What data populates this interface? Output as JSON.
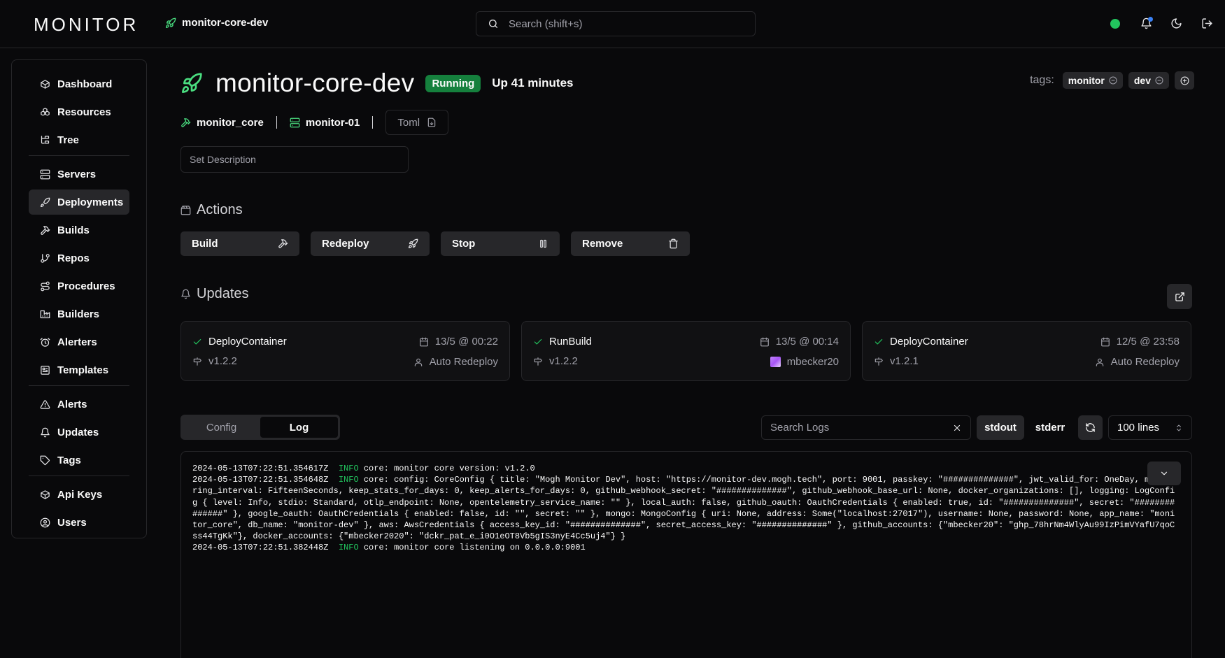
{
  "app": {
    "logo": "MONITOR",
    "breadcrumb": "monitor-core-dev",
    "search_placeholder": "Search (shift+s)",
    "status_color": "#22c55e"
  },
  "sidebar": {
    "items": [
      {
        "label": "Dashboard",
        "icon": "box-icon"
      },
      {
        "label": "Resources",
        "icon": "boxes-icon"
      },
      {
        "label": "Tree",
        "icon": "tree-icon"
      },
      {
        "label": "Servers",
        "icon": "server-icon"
      },
      {
        "label": "Deployments",
        "icon": "rocket-icon",
        "active": true
      },
      {
        "label": "Builds",
        "icon": "hammer-icon"
      },
      {
        "label": "Repos",
        "icon": "git-branch-icon"
      },
      {
        "label": "Procedures",
        "icon": "route-icon"
      },
      {
        "label": "Builders",
        "icon": "factory-icon"
      },
      {
        "label": "Alerters",
        "icon": "alarm-icon"
      },
      {
        "label": "Templates",
        "icon": "template-icon"
      },
      {
        "label": "Alerts",
        "icon": "alert-triangle-icon"
      },
      {
        "label": "Updates",
        "icon": "bell-icon"
      },
      {
        "label": "Tags",
        "icon": "tag-icon"
      },
      {
        "label": "Api Keys",
        "icon": "box-icon"
      },
      {
        "label": "Users",
        "icon": "user-circle-icon"
      }
    ]
  },
  "deployment": {
    "name": "monitor-core-dev",
    "state": "Running",
    "state_color": "#15803d",
    "uptime": "Up 41 minutes",
    "build": "monitor_core",
    "server": "monitor-01",
    "toml_label": "Toml",
    "description_placeholder": "Set Description"
  },
  "tags": {
    "label": "tags:",
    "items": [
      "monitor",
      "dev"
    ]
  },
  "actions": {
    "title": "Actions",
    "buttons": [
      "Build",
      "Redeploy",
      "Stop",
      "Remove"
    ]
  },
  "updates": {
    "title": "Updates",
    "items": [
      {
        "operation": "DeployContainer",
        "version": "v1.2.2",
        "time": "13/5 @ 00:22",
        "user": "Auto Redeploy"
      },
      {
        "operation": "RunBuild",
        "version": "v1.2.2",
        "time": "13/5 @ 00:14",
        "user": "mbecker20"
      },
      {
        "operation": "DeployContainer",
        "version": "v1.2.1",
        "time": "12/5 @ 23:58",
        "user": "Auto Redeploy"
      }
    ]
  },
  "log_panel": {
    "tabs": [
      "Config",
      "Log"
    ],
    "active_tab": "Log",
    "search_placeholder": "Search Logs",
    "stdout_label": "stdout",
    "stderr_label": "stderr",
    "lines_value": "100 lines",
    "lines": [
      {
        "ts": "2024-05-13T07:22:51.354617Z",
        "level": "INFO",
        "msg": "core: monitor core version: v1.2.0"
      },
      {
        "ts": "2024-05-13T07:22:51.354648Z",
        "level": "INFO",
        "msg": "core: config: CoreConfig { title: \"Mogh Monitor Dev\", host: \"https://monitor-dev.mogh.tech\", port: 9001, passkey: \"##############\", jwt_valid_for: OneDay, monitoring_interval: FifteenSeconds, keep_stats_for_days: 0, keep_alerts_for_days: 0, github_webhook_secret: \"##############\", github_webhook_base_url: None, docker_organizations: [], logging: LogConfig { level: Info, stdio: Standard, otlp_endpoint: None, opentelemetry_service_name: \"\" }, local_auth: false, github_oauth: OauthCredentials { enabled: true, id: \"##############\", secret: \"##############\" }, google_oauth: OauthCredentials { enabled: false, id: \"\", secret: \"\" }, mongo: MongoConfig { uri: None, address: Some(\"localhost:27017\"), username: None, password: None, app_name: \"monitor_core\", db_name: \"monitor-dev\" }, aws: AwsCredentials { access_key_id: \"##############\", secret_access_key: \"##############\" }, github_accounts: {\"mbecker20\": \"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\"}, docker_accounts: {\"mbecker2020\": \"dckr_pat_e_i0O1eOT8Vb5gIS3nyE4Cc5uj4\"} }"
      },
      {
        "ts": "2024-05-13T07:22:51.382448Z",
        "level": "INFO",
        "msg": "core: monitor core listening on 0.0.0.0:9001"
      }
    ]
  }
}
